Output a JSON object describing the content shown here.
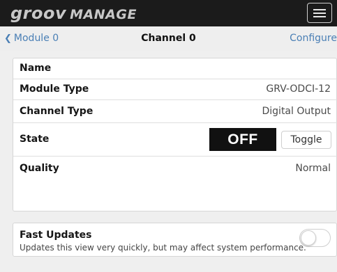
{
  "header": {
    "brand": "groov",
    "product": "MANAGE",
    "menu_icon": "hamburger-menu-icon"
  },
  "subnav": {
    "back_label": "Module 0",
    "title": "Channel 0",
    "configure_label": "Configure"
  },
  "details": {
    "name_label": "Name",
    "name_value": "",
    "module_type_label": "Module Type",
    "module_type_value": "GRV-ODCI-12",
    "channel_type_label": "Channel Type",
    "channel_type_value": "Digital Output",
    "state_label": "State",
    "state_value": "OFF",
    "toggle_label": "Toggle",
    "quality_label": "Quality",
    "quality_value": "Normal"
  },
  "fast_updates": {
    "label": "Fast Updates",
    "description": "Updates this view very quickly, but may affect system performance.",
    "enabled": false
  },
  "colors": {
    "topbar": "#1b1b1b",
    "link": "#4a7fb5",
    "state_badge": "#111111"
  }
}
